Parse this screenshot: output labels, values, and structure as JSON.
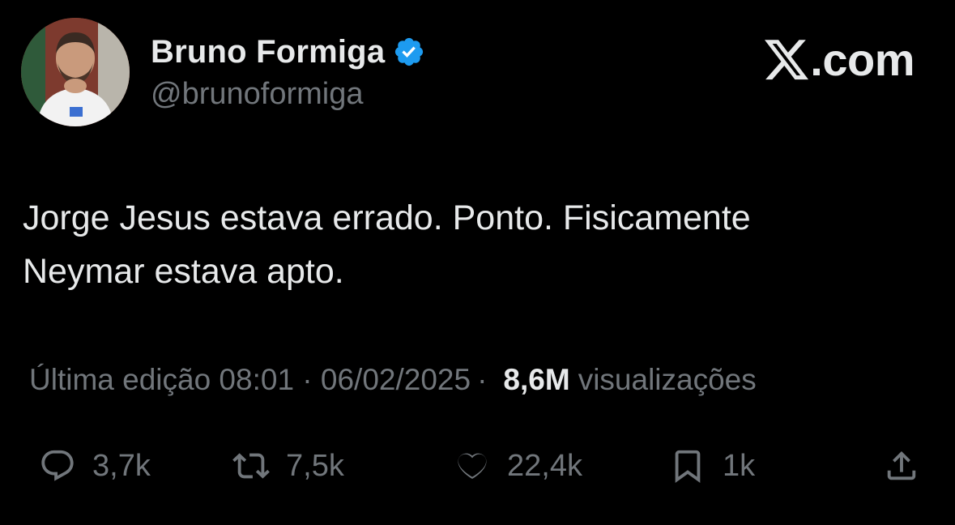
{
  "author": {
    "display_name": "Bruno Formiga",
    "handle": "@brunoformiga",
    "verified": true,
    "avatar_icon": "profile-photo",
    "verified_color": "#1d9bf0"
  },
  "brand": {
    "icon": "x-logo-icon",
    "text": ".com"
  },
  "tweet": {
    "text": "Jorge Jesus estava errado. Ponto. Fisicamente\nNeymar estava apto."
  },
  "meta": {
    "edited_label": "Última edição 08:01 · 06/02/2025",
    "separator": "·",
    "views_count": "8,6M",
    "views_label": "visualizações"
  },
  "actions": {
    "replies": {
      "icon": "reply-icon",
      "count": "3,7k"
    },
    "reposts": {
      "icon": "repost-icon",
      "count": "7,5k"
    },
    "likes": {
      "icon": "heart-icon",
      "count": "22,4k"
    },
    "bookmarks": {
      "icon": "bookmark-icon",
      "count": "1k"
    },
    "share": {
      "icon": "share-icon"
    }
  },
  "colors": {
    "background": "#000000",
    "primary_text": "#e7e9ea",
    "secondary_text": "#71767b"
  }
}
